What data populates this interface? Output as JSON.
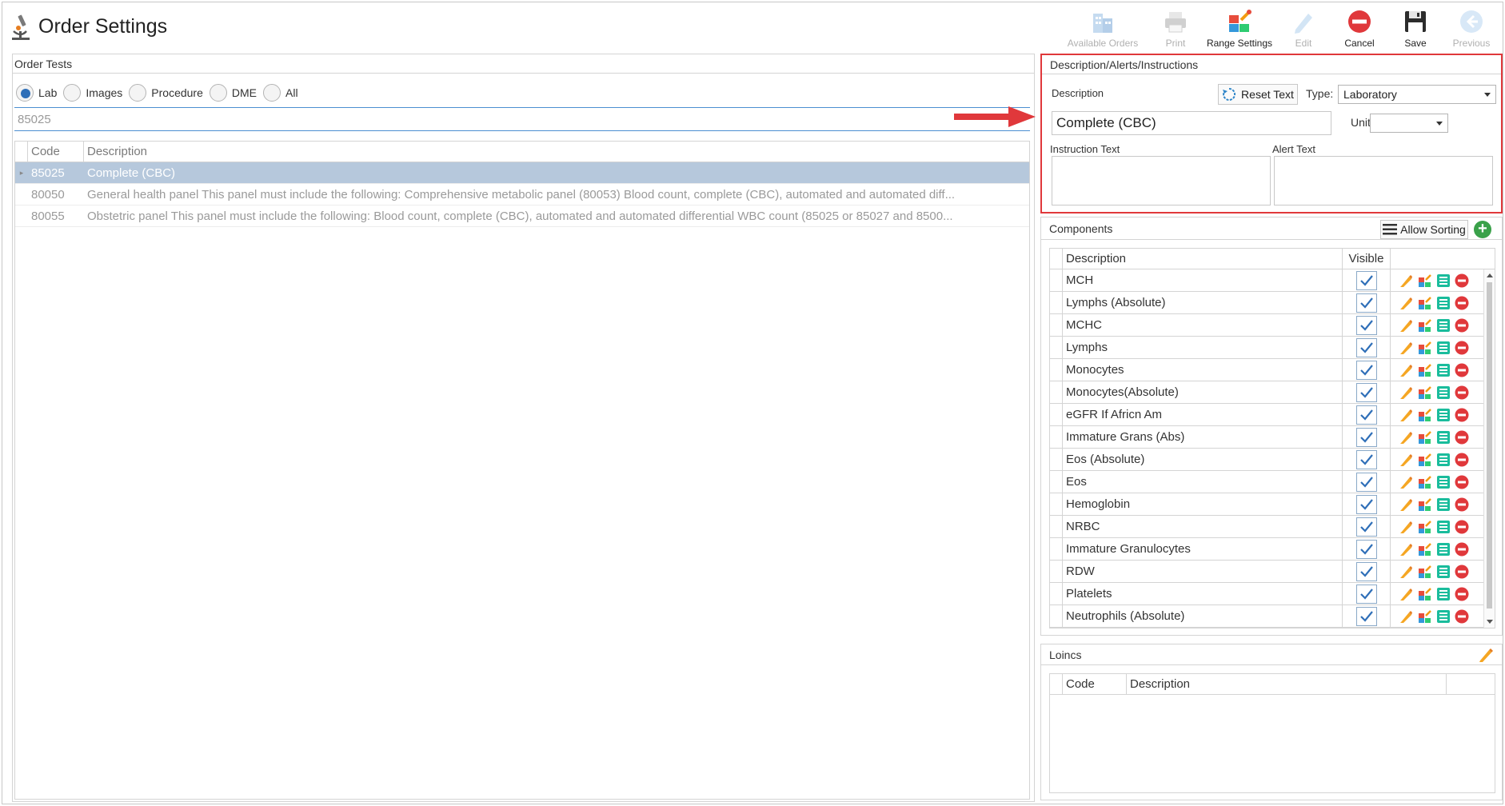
{
  "app": {
    "title": "Order Settings"
  },
  "toolbar": {
    "buttons": [
      {
        "label": "Available Orders",
        "icon": "buildings-icon",
        "enabled": false
      },
      {
        "label": "Print",
        "icon": "printer-icon",
        "enabled": false
      },
      {
        "label": "Range Settings",
        "icon": "range-settings-icon",
        "enabled": true
      },
      {
        "label": "Edit",
        "icon": "pencil-icon",
        "enabled": false
      },
      {
        "label": "Cancel",
        "icon": "cancel-icon",
        "enabled": true
      },
      {
        "label": "Save",
        "icon": "floppy-disk-icon",
        "enabled": true
      },
      {
        "label": "Previous",
        "icon": "arrow-left-icon",
        "enabled": false
      }
    ]
  },
  "order_tests": {
    "header": "Order Tests",
    "radios": [
      {
        "label": "Lab",
        "checked": true
      },
      {
        "label": "Images",
        "checked": false
      },
      {
        "label": "Procedure",
        "checked": false
      },
      {
        "label": "DME",
        "checked": false
      },
      {
        "label": "All",
        "checked": false
      }
    ],
    "search_value": "85025",
    "columns": {
      "code": "Code",
      "description": "Description"
    },
    "rows": [
      {
        "code": "85025",
        "description": "Complete (CBC)",
        "selected": true
      },
      {
        "code": "80050",
        "description": "General health panel This panel must include the following: Comprehensive metabolic panel (80053) Blood count, complete (CBC), automated and automated diff...",
        "selected": false
      },
      {
        "code": "80055",
        "description": "Obstetric panel This panel must include the following: Blood count, complete (CBC), automated and automated differential WBC count (85025 or 85027 and 8500...",
        "selected": false
      }
    ]
  },
  "description_panel": {
    "header": "Description/Alerts/Instructions",
    "description_label": "Description",
    "reset_label": "Reset Text",
    "type_label": "Type:",
    "type_value": "Laboratory",
    "description_value": "Complete (CBC)",
    "unit_label": "Unit",
    "unit_value": "",
    "instruction_label": "Instruction Text",
    "alert_label": "Alert Text"
  },
  "components": {
    "header": "Components",
    "allow_sorting_label": "Allow Sorting",
    "add_label": "+",
    "columns": {
      "description": "Description",
      "visible": "Visible"
    },
    "rows": [
      {
        "description": "MCH",
        "visible": true
      },
      {
        "description": "Lymphs (Absolute)",
        "visible": true
      },
      {
        "description": "MCHC",
        "visible": true
      },
      {
        "description": "Lymphs",
        "visible": true
      },
      {
        "description": "Monocytes",
        "visible": true
      },
      {
        "description": "Monocytes(Absolute)",
        "visible": true
      },
      {
        "description": "eGFR If Africn Am",
        "visible": true
      },
      {
        "description": "Immature Grans (Abs)",
        "visible": true
      },
      {
        "description": "Eos (Absolute)",
        "visible": true
      },
      {
        "description": "Eos",
        "visible": true
      },
      {
        "description": "Hemoglobin",
        "visible": true
      },
      {
        "description": "NRBC",
        "visible": true
      },
      {
        "description": "Immature Granulocytes",
        "visible": true
      },
      {
        "description": "RDW",
        "visible": true
      },
      {
        "description": "Platelets",
        "visible": true
      },
      {
        "description": "Neutrophils (Absolute)",
        "visible": true
      }
    ]
  },
  "loincs": {
    "header": "Loincs",
    "columns": {
      "code": "Code",
      "description": "Description"
    }
  },
  "colors": {
    "accent": "#2f6fb8",
    "selected_row": "#b6c8dc",
    "highlight_border": "#e0383b",
    "cancel_red": "#e0383b",
    "add_green": "#3aa14a"
  }
}
